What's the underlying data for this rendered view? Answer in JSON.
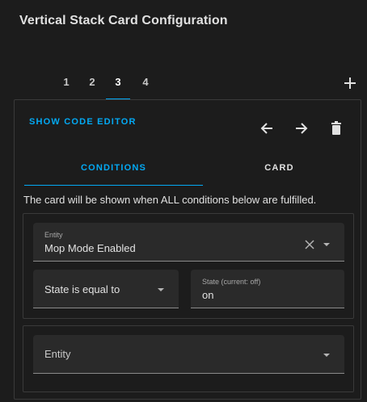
{
  "dialog": {
    "title": "Vertical Stack Card Configuration"
  },
  "stack_tabs": [
    {
      "label": "1",
      "active": false
    },
    {
      "label": "2",
      "active": false
    },
    {
      "label": "3",
      "active": true
    },
    {
      "label": "4",
      "active": false
    }
  ],
  "card_editor": {
    "show_code_editor_label": "SHOW CODE EDITOR",
    "tabs": [
      {
        "label": "CONDITIONS",
        "active": true
      },
      {
        "label": "CARD",
        "active": false
      }
    ],
    "info_text": "The card will be shown when ALL conditions below are fulfilled.",
    "conditions": [
      {
        "entity_label": "Entity",
        "entity_value": "Mop Mode Enabled",
        "state_operator": "State is equal to",
        "state_label": "State (current: off)",
        "state_value": "on"
      }
    ],
    "new_condition": {
      "entity_placeholder": "Entity"
    }
  },
  "colors": {
    "accent": "#03a9f4",
    "background": "#1c1c1c",
    "field_background": "#2a2a2a",
    "border": "#3a3a3a"
  },
  "icons": [
    "plus-icon",
    "arrow-left-icon",
    "arrow-right-icon",
    "delete-icon",
    "close-icon",
    "chevron-down-icon"
  ]
}
